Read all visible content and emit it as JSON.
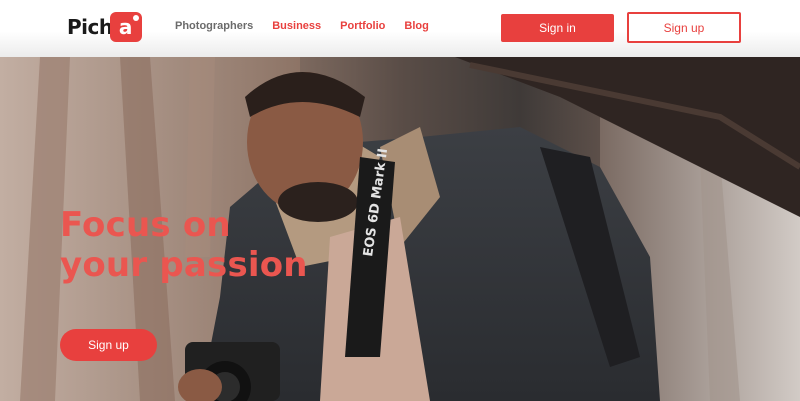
{
  "brand": {
    "logo_text": "Pich",
    "logo_badge": "a"
  },
  "nav": {
    "items": [
      {
        "label": "Photographers",
        "color": "#6b6b6b"
      },
      {
        "label": "Business",
        "color": "#e8403e"
      },
      {
        "label": "Portfolio",
        "color": "#e8403e"
      },
      {
        "label": "Blog",
        "color": "#e8403e"
      }
    ]
  },
  "auth": {
    "sign_in_label": "Sign in",
    "sign_up_label": "Sign up"
  },
  "hero": {
    "headline_line1": "Focus on",
    "headline_line2": "your passion",
    "cta_label": "Sign up",
    "camera_strap_text": "EOS 6D Mark II",
    "image": "photographer-with-camera-photo"
  },
  "colors": {
    "accent": "#e8403e",
    "headline": "#ea5650",
    "nav_gray": "#6b6b6b"
  }
}
